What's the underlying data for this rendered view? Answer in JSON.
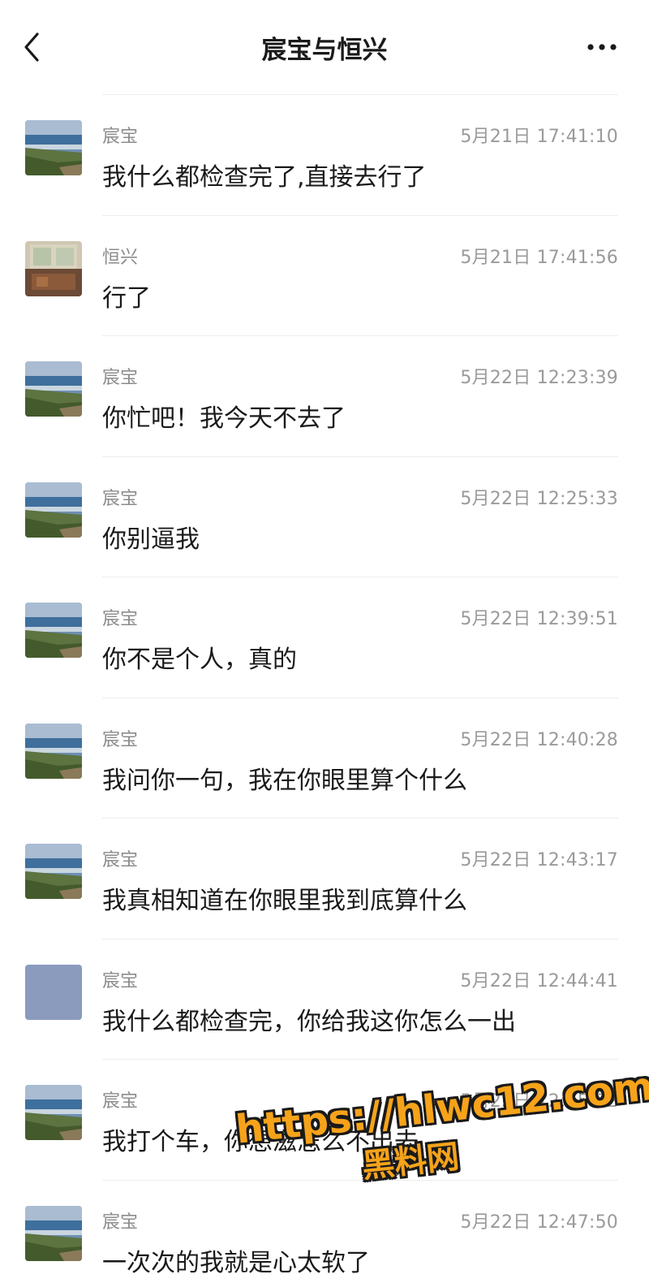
{
  "header": {
    "title": "宸宝与恒兴",
    "back_icon": "chevron-left-icon",
    "more_icon": "more-dots-icon"
  },
  "messages": [
    {
      "sender": "宸宝",
      "time": "5月21日 17:41:10",
      "text": "我什么都检查完了,直接去行了",
      "avatar": "landscape"
    },
    {
      "sender": "恒兴",
      "time": "5月21日 17:41:56",
      "text": "行了",
      "avatar": "room"
    },
    {
      "sender": "宸宝",
      "time": "5月22日 12:23:39",
      "text": "你忙吧！我今天不去了",
      "avatar": "landscape"
    },
    {
      "sender": "宸宝",
      "time": "5月22日 12:25:33",
      "text": "你别逼我",
      "avatar": "landscape"
    },
    {
      "sender": "宸宝",
      "time": "5月22日 12:39:51",
      "text": "你不是个人，真的",
      "avatar": "landscape"
    },
    {
      "sender": "宸宝",
      "time": "5月22日 12:40:28",
      "text": "我问你一句，我在你眼里算个什么",
      "avatar": "landscape"
    },
    {
      "sender": "宸宝",
      "time": "5月22日 12:43:17",
      "text": "我真相知道在你眼里我到底算什么",
      "avatar": "landscape"
    },
    {
      "sender": "宸宝",
      "time": "5月22日 12:44:41",
      "text": "我什么都检查完，你给我这你怎么一出",
      "avatar": "plain"
    },
    {
      "sender": "宸宝",
      "time": "5月22日 12:45:52",
      "text": "我打个车，你想滋怎么不出去",
      "avatar": "landscape"
    },
    {
      "sender": "宸宝",
      "time": "5月22日 12:47:50",
      "text": "一次次的我就是心太软了",
      "avatar": "landscape"
    }
  ],
  "watermark": {
    "url": "https://hlwc12.com",
    "name": "黑料网"
  },
  "colors": {
    "watermark_fill": "#f6a31a",
    "plain_avatar": "#8a9bbd"
  }
}
